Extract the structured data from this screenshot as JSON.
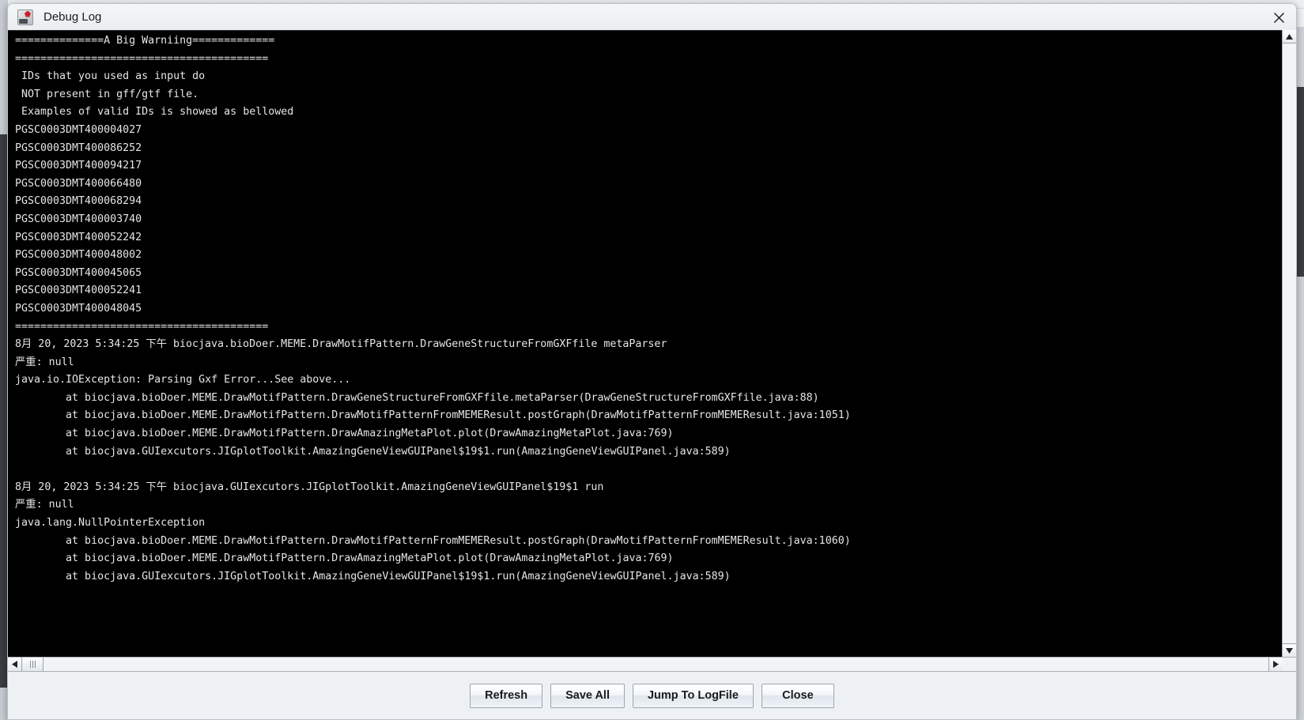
{
  "window": {
    "title": "Debug Log",
    "icon": "biojava-app-icon",
    "close_label": "✕"
  },
  "log": {
    "lines": [
      "==============A Big Warniing=============",
      "========================================",
      " IDs that you used as input do",
      " NOT present in gff/gtf file.",
      " Examples of valid IDs is showed as bellowed",
      "PGSC0003DMT400004027",
      "PGSC0003DMT400086252",
      "PGSC0003DMT400094217",
      "PGSC0003DMT400066480",
      "PGSC0003DMT400068294",
      "PGSC0003DMT400003740",
      "PGSC0003DMT400052242",
      "PGSC0003DMT400048002",
      "PGSC0003DMT400045065",
      "PGSC0003DMT400052241",
      "PGSC0003DMT400048045",
      "========================================",
      "8月 20, 2023 5:34:25 下午 biocjava.bioDoer.MEME.DrawMotifPattern.DrawGeneStructureFromGXFfile metaParser",
      "严重: null",
      "java.io.IOException: Parsing Gxf Error...See above...",
      "        at biocjava.bioDoer.MEME.DrawMotifPattern.DrawGeneStructureFromGXFfile.metaParser(DrawGeneStructureFromGXFfile.java:88)",
      "        at biocjava.bioDoer.MEME.DrawMotifPattern.DrawMotifPatternFromMEMEResult.postGraph(DrawMotifPatternFromMEMEResult.java:1051)",
      "        at biocjava.bioDoer.MEME.DrawMotifPattern.DrawAmazingMetaPlot.plot(DrawAmazingMetaPlot.java:769)",
      "        at biocjava.GUIexcutors.JIGplotToolkit.AmazingGeneViewGUIPanel$19$1.run(AmazingGeneViewGUIPanel.java:589)",
      "",
      "8月 20, 2023 5:34:25 下午 biocjava.GUIexcutors.JIGplotToolkit.AmazingGeneViewGUIPanel$19$1 run",
      "严重: null",
      "java.lang.NullPointerException",
      "        at biocjava.bioDoer.MEME.DrawMotifPattern.DrawMotifPatternFromMEMEResult.postGraph(DrawMotifPatternFromMEMEResult.java:1060)",
      "        at biocjava.bioDoer.MEME.DrawMotifPattern.DrawAmazingMetaPlot.plot(DrawAmazingMetaPlot.java:769)",
      "        at biocjava.GUIexcutors.JIGplotToolkit.AmazingGeneViewGUIPanel$19$1.run(AmazingGeneViewGUIPanel.java:589)"
    ]
  },
  "scrollbars": {
    "vertical": {
      "up_arrow": "▲",
      "down_arrow": "▼"
    },
    "horizontal": {
      "left_arrow": "◀",
      "right_arrow": "▶"
    }
  },
  "buttons": [
    {
      "id": "refresh",
      "label": "Refresh"
    },
    {
      "id": "save-all",
      "label": "Save All"
    },
    {
      "id": "jump-to-logfile",
      "label": "Jump To LogFile"
    },
    {
      "id": "close",
      "label": "Close"
    }
  ],
  "colors": {
    "log_background": "#000000",
    "log_text": "#e6e6e6",
    "window_chrome": "#eef1f4",
    "border": "#a7b0b8"
  }
}
